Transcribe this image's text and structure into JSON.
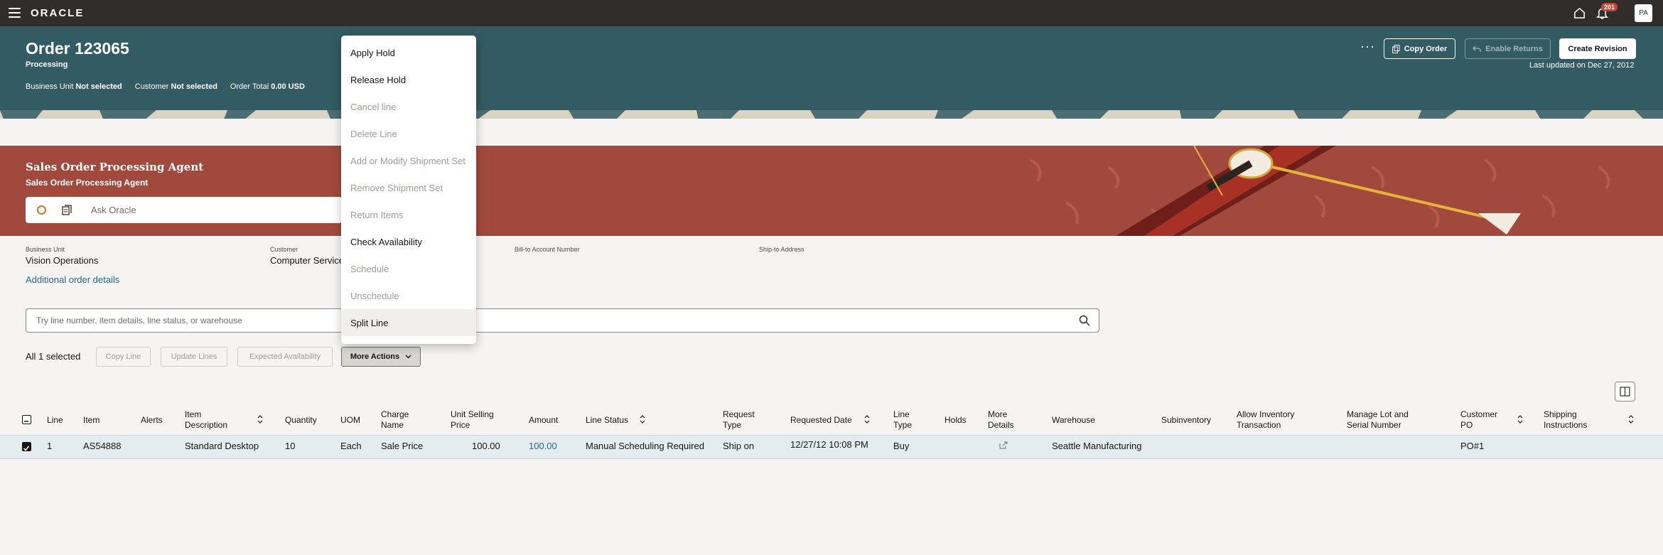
{
  "topbar": {
    "logo": "ORACLE",
    "notifications_count": "201",
    "avatar": "PA"
  },
  "order": {
    "title": "Order 123065",
    "status": "Processing",
    "business_unit_label": "Business Unit",
    "business_unit_value": "Not selected",
    "customer_label": "Customer",
    "customer_value": "Not selected",
    "order_total_label": "Order Total",
    "order_total_value": "0.00 USD",
    "more_label": "···",
    "copy_order": "Copy Order",
    "enable_returns": "Enable Returns",
    "create_revision": "Create Revision",
    "last_updated": "Last updated on Dec 27, 2012"
  },
  "agent": {
    "title": "Sales Order Processing Agent",
    "subtitle": "Sales Order Processing Agent",
    "ask_placeholder": "Ask Oracle"
  },
  "details": {
    "business_unit_label": "Business Unit",
    "business_unit_value": "Vision Operations",
    "customer_label": "Customer",
    "customer_value": "Computer Service",
    "bill_to_label": "Bill-to Account Number",
    "ship_to_label": "Ship-to Address",
    "additional_link": "Additional order details"
  },
  "line_search": {
    "placeholder": "Try line number, item details, line status, or warehouse"
  },
  "toolbar": {
    "selected": "All 1 selected",
    "copy_line": "Copy Line",
    "update_lines": "Update Lines",
    "expected_availability": "Expected Availability",
    "more_actions": "More Actions"
  },
  "table": {
    "headers": {
      "line": "Line",
      "item": "Item",
      "alerts": "Alerts",
      "item_desc_1": "Item",
      "item_desc_2": "Description",
      "quantity": "Quantity",
      "uom": "UOM",
      "charge_1": "Charge",
      "charge_2": "Name",
      "unit_price_1": "Unit Selling",
      "unit_price_2": "Price",
      "amount": "Amount",
      "line_status": "Line Status",
      "request_type_1": "Request",
      "request_type_2": "Type",
      "requested_date": "Requested Date",
      "line_type_1": "Line",
      "line_type_2": "Type",
      "holds": "Holds",
      "more_details_1": "More",
      "more_details_2": "Details",
      "warehouse": "Warehouse",
      "subinventory": "Subinventory",
      "allow_inv_1": "Allow Inventory",
      "allow_inv_2": "Transaction",
      "manage_lot_1": "Manage Lot and",
      "manage_lot_2": "Serial Number",
      "customer_po_1": "Customer",
      "customer_po_2": "PO",
      "shipping_1": "Shipping",
      "shipping_2": "Instructions"
    },
    "row": {
      "line": "1",
      "item": "AS54888",
      "item_description": "Standard Desktop",
      "quantity": "10",
      "uom": "Each",
      "charge_name": "Sale Price",
      "unit_price": "100.00",
      "amount": "100.00",
      "line_status": "Manual Scheduling Required",
      "request_type": "Ship on",
      "requested_date": "12/27/12 10:08 PM",
      "line_type": "Buy",
      "warehouse": "Seattle Manufacturing",
      "customer_po": "PO#1"
    }
  },
  "dropdown": {
    "items": [
      {
        "label": "Apply Hold"
      },
      {
        "label": "Release Hold"
      },
      {
        "label": "Cancel line"
      },
      {
        "label": "Delete Line"
      },
      {
        "label": "Add or Modify Shipment Set"
      },
      {
        "label": "Remove Shipment Set"
      },
      {
        "label": "Return Items"
      },
      {
        "label": "Check Availability"
      },
      {
        "label": "Schedule"
      },
      {
        "label": "Unschedule"
      },
      {
        "label": "Split Line"
      }
    ]
  },
  "colors": {
    "topbar": "#312d2a",
    "header": "#325b63",
    "agent_band": "#a1493d",
    "link": "#1e6b8a",
    "badge": "#c74634"
  }
}
